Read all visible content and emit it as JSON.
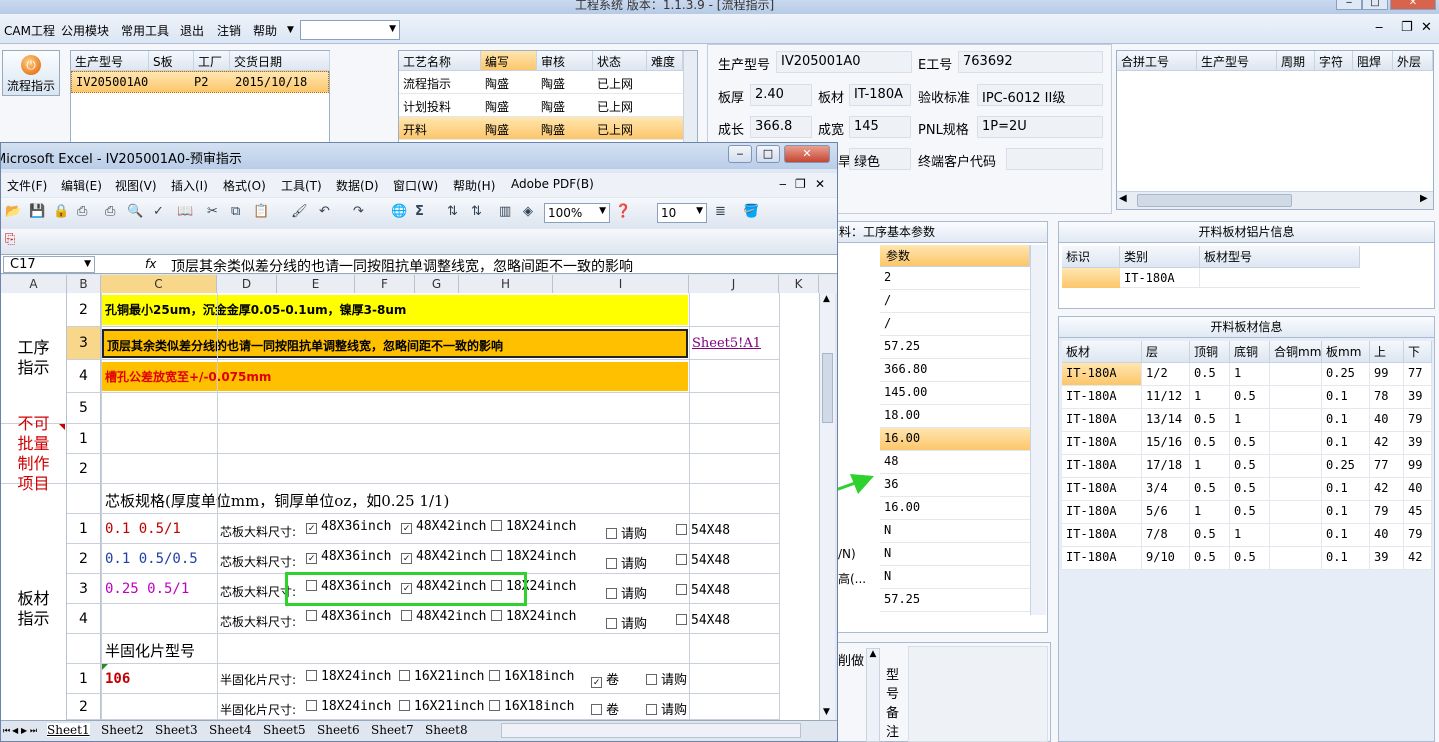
{
  "app": {
    "title": "工程系统  版本：1.1.3.9 - [流程指示]",
    "partial_left": "CAM工程"
  },
  "menu": [
    "CAM工程",
    "公用模块",
    "常用工具",
    "退出",
    "注销",
    "帮助"
  ],
  "flow_button": "流程指示",
  "order_grid": {
    "headers": [
      "生产型号",
      "S板",
      "工厂",
      "交货日期"
    ],
    "row": [
      "IV205001A0",
      "",
      "P2",
      "2015/10/18"
    ]
  },
  "process_grid": {
    "headers": [
      "工艺名称",
      "编写",
      "审核",
      "状态",
      "难度"
    ],
    "rows": [
      [
        "流程指示",
        "陶盛",
        "陶盛",
        "已上网"
      ],
      [
        "计划投料",
        "陶盛",
        "陶盛",
        "已上网"
      ],
      [
        "开料",
        "陶盛",
        "陶盛",
        "已上网"
      ]
    ]
  },
  "info": {
    "model_label": "生产型号",
    "model": "IV205001A0",
    "e_label": "E工号",
    "e": "763692",
    "thick_label": "板厚",
    "thick": "2.40",
    "mat_label": "板材",
    "mat": "IT-180A",
    "std_label": "验收标准",
    "std": "IPC-6012 II级",
    "len_label": "成长",
    "len": "366.8",
    "wid_label": "成宽",
    "wid": "145",
    "pnl_label": "PNL规格",
    "pnl": "1P=2U",
    "color_partial": "旱",
    "color": "绿色",
    "cust_label": "终端客户代码"
  },
  "merge_grid": {
    "headers": [
      "合拼工号",
      "生产型号",
      "周期",
      "字符",
      "阻焊",
      "外层"
    ]
  },
  "params_panel": {
    "title": "料：工序基本参数",
    "header": "参数",
    "values": [
      "2",
      "/",
      "/",
      "57.25",
      "366.80",
      "145.00",
      "18.00",
      "16.00",
      "48",
      "36",
      "16.00",
      "N",
      "N",
      "N",
      "57.25"
    ],
    "labels": {
      "12": "/N)",
      "13": "高(..."
    }
  },
  "bottom_mid": {
    "label": "削做",
    "vert": "型号备注"
  },
  "al_panel": {
    "title": "开料板材铝片信息",
    "headers": [
      "标识",
      "类别",
      "板材型号"
    ],
    "row": [
      "",
      "IT-180A",
      ""
    ]
  },
  "board_panel": {
    "title": "开料板材信息",
    "headers": [
      "板材",
      "层",
      "顶铜",
      "底铜",
      "合铜mm",
      "板mm",
      "上",
      "下"
    ],
    "rows": [
      [
        "IT-180A",
        "1/2",
        "0.5",
        "1",
        "",
        "0.25",
        "99",
        "77"
      ],
      [
        "IT-180A",
        "11/12",
        "1",
        "0.5",
        "",
        "0.1",
        "78",
        "39"
      ],
      [
        "IT-180A",
        "13/14",
        "0.5",
        "1",
        "",
        "0.1",
        "40",
        "79"
      ],
      [
        "IT-180A",
        "15/16",
        "0.5",
        "0.5",
        "",
        "0.1",
        "42",
        "39"
      ],
      [
        "IT-180A",
        "17/18",
        "1",
        "0.5",
        "",
        "0.25",
        "77",
        "99"
      ],
      [
        "IT-180A",
        "3/4",
        "0.5",
        "0.5",
        "",
        "0.1",
        "42",
        "40"
      ],
      [
        "IT-180A",
        "5/6",
        "1",
        "0.5",
        "",
        "0.1",
        "79",
        "45"
      ],
      [
        "IT-180A",
        "7/8",
        "0.5",
        "1",
        "",
        "0.1",
        "40",
        "79"
      ],
      [
        "IT-180A",
        "9/10",
        "0.5",
        "0.5",
        "",
        "0.1",
        "39",
        "42"
      ]
    ]
  },
  "excel": {
    "title": "Microsoft Excel - IV205001A0-预审指示",
    "menu": [
      "文件(F)",
      "编辑(E)",
      "视图(V)",
      "插入(I)",
      "格式(O)",
      "工具(T)",
      "数据(D)",
      "窗口(W)",
      "帮助(H)",
      "Adobe PDF(B)"
    ],
    "zoom": "100%",
    "fontsize": "10",
    "namebox": "C17",
    "fx": "fx",
    "formula": "顶层其余类似差分线的也请一同按阻抗单调整线宽，忽略间距不一致的影响",
    "cols": [
      "A",
      "B",
      "C",
      "D",
      "E",
      "F",
      "G",
      "H",
      "I",
      "J",
      "K"
    ],
    "sec1": "工序指示",
    "rows1": [
      {
        "n": "2",
        "text": "孔铜最小25um，沉金金厚0.05-0.1um，镍厚3-8um"
      },
      {
        "n": "3",
        "text": "顶层其余类似差分线的也请一同按阻抗单调整线宽，忽略间距不一致的影响",
        "link": "Sheet5!A1"
      },
      {
        "n": "4",
        "text": "槽孔公差放宽至+/-0.075mm"
      },
      {
        "n": "5",
        "text": ""
      }
    ],
    "sec2": "不可批量制作项目",
    "rows2": [
      {
        "n": "1"
      },
      {
        "n": "2"
      }
    ],
    "core_title": "芯板规格(厚度单位mm，铜厚单位oz，如0.25 1/1)",
    "sec3": "板材指示",
    "core_label": "芯板大料尺寸:",
    "core_opts": [
      "48X36inch",
      "48X42inch",
      "18X24inch",
      "请购",
      "54X48"
    ],
    "core_rows": [
      {
        "n": "1",
        "spec": "0.1  0.5/1",
        "color": "#c00000",
        "checks": [
          true,
          true,
          false,
          false,
          false
        ]
      },
      {
        "n": "2",
        "spec": "0.1  0.5/0.5",
        "color": "#1f3fa8",
        "checks": [
          true,
          true,
          false,
          false,
          false
        ]
      },
      {
        "n": "3",
        "spec": "0.25  0.5/1",
        "color": "#c000c0",
        "checks": [
          false,
          true,
          false,
          false,
          false
        ]
      },
      {
        "n": "4",
        "spec": "",
        "color": "#000",
        "checks": [
          false,
          false,
          false,
          false,
          false
        ]
      }
    ],
    "pp_title": "半固化片型号",
    "pp_label": "半固化片尺寸:",
    "pp_opts": [
      "18X24inch",
      "16X21inch",
      "16X18inch",
      "卷",
      "请购"
    ],
    "pp_rows": [
      {
        "n": "1",
        "spec": "106",
        "checks": [
          false,
          false,
          false,
          true,
          false
        ]
      },
      {
        "n": "2",
        "spec": "",
        "checks": [
          false,
          false,
          false,
          false,
          false
        ]
      }
    ],
    "sheets": [
      "Sheet1",
      "Sheet2",
      "Sheet3",
      "Sheet4",
      "Sheet5",
      "Sheet6",
      "Sheet7",
      "Sheet8"
    ]
  },
  "colors": {
    "accent_green": "#2fd12f",
    "selected": "#fcc66a",
    "yellow": "#ffff00",
    "orange": "#ffc000"
  }
}
